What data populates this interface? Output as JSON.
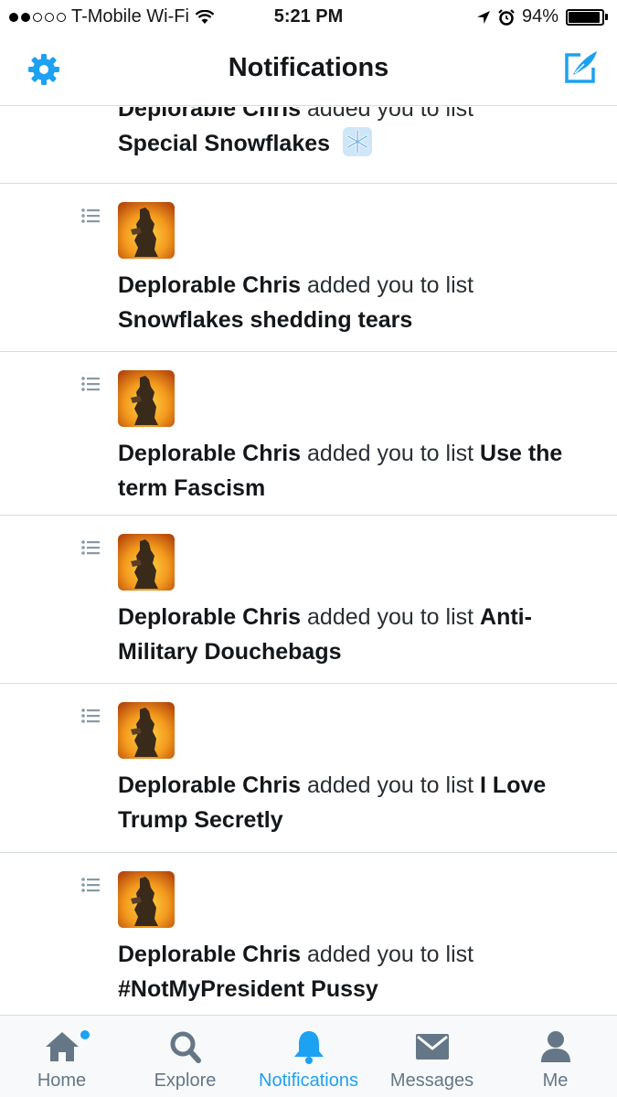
{
  "status_bar": {
    "carrier": "T-Mobile Wi-Fi",
    "time": "5:21 PM",
    "battery": "94%",
    "battery_level": 0.94,
    "icons": [
      "signal-dots-icon",
      "wifi-icon",
      "location-arrow-icon",
      "alarm-icon",
      "battery-icon"
    ]
  },
  "nav": {
    "title": "Notifications",
    "left_icon": "gear-icon",
    "right_icon": "compose-tweet-icon",
    "accent": "#1da1f2"
  },
  "notifications": [
    {
      "user": "Deplorable Chris",
      "action": " added you to list ",
      "list": "Special Snowflakes",
      "emoji": "❄️",
      "partial": true
    },
    {
      "user": "Deplorable Chris",
      "action": " added you to list ",
      "list": "Snowflakes shedding tears"
    },
    {
      "user": "Deplorable Chris",
      "action": " added you to list ",
      "list": "Use the term Fascism"
    },
    {
      "user": "Deplorable Chris",
      "action": " added you to list ",
      "list": "Anti-Military Douchebags"
    },
    {
      "user": "Deplorable Chris",
      "action": " added you to list ",
      "list": "I Love Trump Secretly"
    },
    {
      "user": "Deplorable Chris",
      "action": " added you to list ",
      "list": "#NotMyPresident Pussy"
    }
  ],
  "tabs": [
    {
      "label": "Home",
      "icon": "home-icon",
      "active": false,
      "badge": true
    },
    {
      "label": "Explore",
      "icon": "search-icon",
      "active": false
    },
    {
      "label": "Notifications",
      "icon": "bell-icon",
      "active": true
    },
    {
      "label": "Messages",
      "icon": "envelope-icon",
      "active": false
    },
    {
      "label": "Me",
      "icon": "person-icon",
      "active": false
    }
  ]
}
